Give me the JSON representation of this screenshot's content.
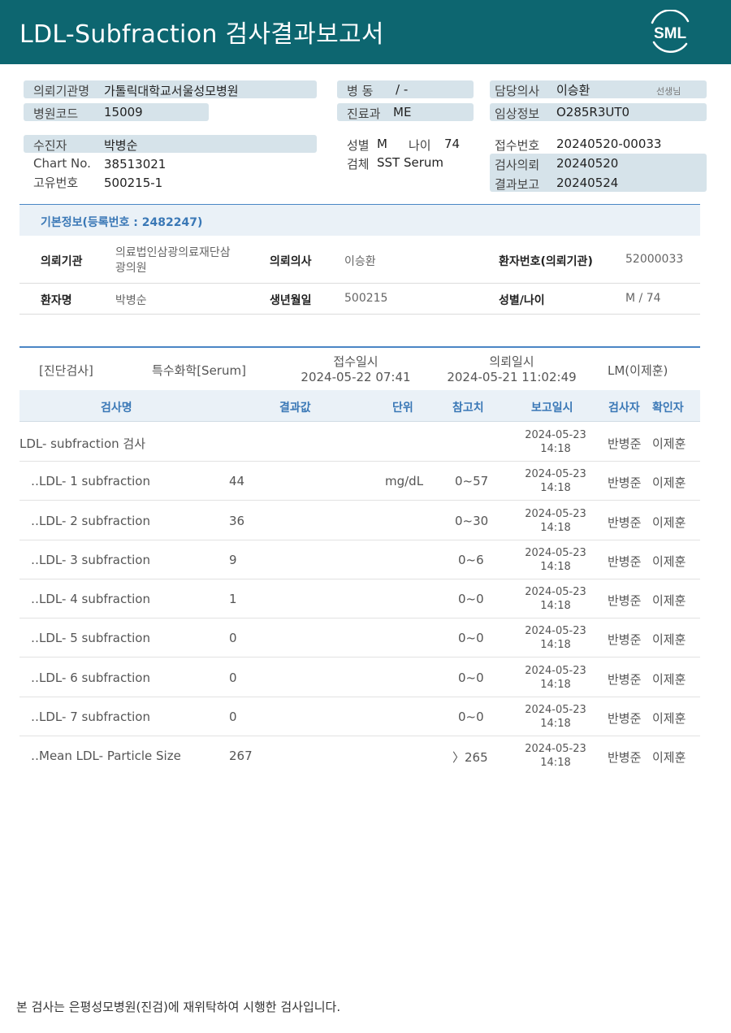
{
  "header": {
    "title": "LDL-Subfraction 검사결과보고서",
    "logo_text": "SML"
  },
  "top_info": {
    "institution_label": "의뢰기관명",
    "institution": "가톨릭대학교서울성모병원",
    "hospital_code_label": "병원코드",
    "hospital_code": "15009",
    "ward_label": "병 동",
    "ward": "/ -",
    "department_label": "진료과",
    "department": "ME",
    "doctor_label": "담당의사",
    "doctor": "이승환",
    "doctor_suffix": "선생님",
    "clinical_info_label": "임상정보",
    "clinical_info": "O285R3UT0",
    "patient_label": "수진자",
    "patient": "박병순",
    "chart_label": "Chart No.",
    "chart_no": "38513021",
    "unique_label": "고유번호",
    "unique_no": "500215-1",
    "sex_label": "성별",
    "sex": "M",
    "age_label": "나이",
    "age": "74",
    "specimen_label": "검체",
    "specimen": "SST Serum",
    "receipt_label": "접수번호",
    "receipt_no": "20240520-00033",
    "request_label": "검사의뢰",
    "request_date": "20240520",
    "report_label": "결과보고",
    "report_date": "20240524"
  },
  "basic": {
    "title": "기본정보(등록번호 : 2482247)",
    "rows": [
      {
        "k1": "의뢰기관",
        "v1a": "의료법인삼광의료재단삼",
        "v1b": "광의원",
        "k2": "의뢰의사",
        "v2": "이승환",
        "k3": "환자번호(의뢰기관)",
        "v3": "52000033"
      },
      {
        "k1": "환자명",
        "v1a": "박병순",
        "v1b": "",
        "k2": "생년월일",
        "v2": "500215",
        "k3": "성별/나이",
        "v3": "M / 74"
      }
    ]
  },
  "test_meta": {
    "category": "[진단검사]",
    "type": "특수화학[Serum]",
    "receipt_label": "접수일시",
    "receipt_dt": "2024-05-22 07:41",
    "request_label": "의뢰일시",
    "request_dt": "2024-05-21 11:02:49",
    "lm": "LM(이제훈)"
  },
  "table": {
    "headers": {
      "name": "검사명",
      "result": "결과값",
      "unit": "단위",
      "ref": "참고치",
      "report": "보고일시",
      "tester": "검사자",
      "confirmer": "확인자"
    },
    "rows": [
      {
        "name": "LDL- subfraction 검사",
        "result": "",
        "unit": "",
        "ref": "",
        "date": "2024-05-23",
        "time": "14:18",
        "tester": "반병준",
        "confirmer": "이제훈"
      },
      {
        "name": "‥LDL- 1 subfraction",
        "result": "44",
        "unit": "mg/dL",
        "ref": "0~57",
        "date": "2024-05-23",
        "time": "14:18",
        "tester": "반병준",
        "confirmer": "이제훈"
      },
      {
        "name": "‥LDL- 2 subfraction",
        "result": "36",
        "unit": "",
        "ref": "0~30",
        "date": "2024-05-23",
        "time": "14:18",
        "tester": "반병준",
        "confirmer": "이제훈"
      },
      {
        "name": "‥LDL- 3 subfraction",
        "result": "9",
        "unit": "",
        "ref": "0~6",
        "date": "2024-05-23",
        "time": "14:18",
        "tester": "반병준",
        "confirmer": "이제훈"
      },
      {
        "name": "‥LDL- 4 subfraction",
        "result": "1",
        "unit": "",
        "ref": "0~0",
        "date": "2024-05-23",
        "time": "14:18",
        "tester": "반병준",
        "confirmer": "이제훈"
      },
      {
        "name": "‥LDL- 5 subfraction",
        "result": "0",
        "unit": "",
        "ref": "0~0",
        "date": "2024-05-23",
        "time": "14:18",
        "tester": "반병준",
        "confirmer": "이제훈"
      },
      {
        "name": "‥LDL- 6 subfraction",
        "result": "0",
        "unit": "",
        "ref": "0~0",
        "date": "2024-05-23",
        "time": "14:18",
        "tester": "반병준",
        "confirmer": "이제훈"
      },
      {
        "name": "‥LDL- 7 subfraction",
        "result": "0",
        "unit": "",
        "ref": "0~0",
        "date": "2024-05-23",
        "time": "14:18",
        "tester": "반병준",
        "confirmer": "이제훈"
      },
      {
        "name": "‥Mean LDL- Particle Size",
        "result": "267",
        "unit": "",
        "ref": "〉265",
        "date": "2024-05-23",
        "time": "14:18",
        "tester": "반병준",
        "confirmer": "이제훈"
      }
    ]
  },
  "footer": {
    "note": "본 검사는 은평성모병원(진검)에 재위탁하여 시행한 검사입니다."
  }
}
